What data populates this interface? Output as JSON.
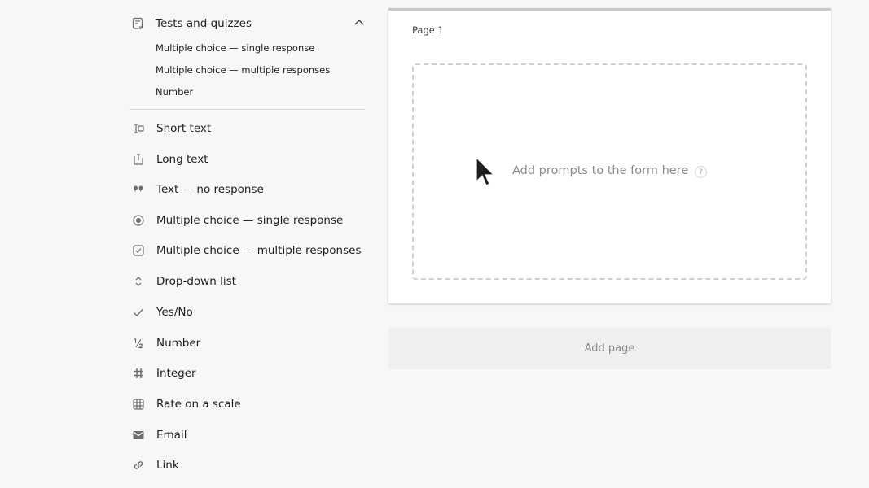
{
  "sidebar": {
    "section": {
      "label": "Tests and quizzes",
      "icon": "quiz-icon",
      "expanded": true,
      "items": [
        {
          "label": "Multiple choice — single response"
        },
        {
          "label": "Multiple choice — multiple responses"
        },
        {
          "label": "Number"
        }
      ]
    },
    "items": [
      {
        "label": "Short text",
        "icon": "short-text-icon"
      },
      {
        "label": "Long text",
        "icon": "long-text-icon"
      },
      {
        "label": "Text — no response",
        "icon": "quote-icon"
      },
      {
        "label": "Multiple choice — single response",
        "icon": "radio-icon"
      },
      {
        "label": "Multiple choice — multiple responses",
        "icon": "checkbox-icon"
      },
      {
        "label": "Drop-down list",
        "icon": "dropdown-icon"
      },
      {
        "label": "Yes/No",
        "icon": "check-icon"
      },
      {
        "label": "Number",
        "icon": "fraction-icon"
      },
      {
        "label": "Integer",
        "icon": "hash-icon"
      },
      {
        "label": "Rate on a scale",
        "icon": "grid-icon"
      },
      {
        "label": "Email",
        "icon": "email-icon"
      },
      {
        "label": "Link",
        "icon": "link-icon"
      }
    ]
  },
  "page": {
    "title": "Page 1",
    "prompt": "Add prompts to the form here",
    "help": "?"
  },
  "add_page": {
    "label": "Add page"
  },
  "colors": {
    "background": "#f7f7f7",
    "card": "#ffffff",
    "muted_text": "#8c8c8c"
  }
}
